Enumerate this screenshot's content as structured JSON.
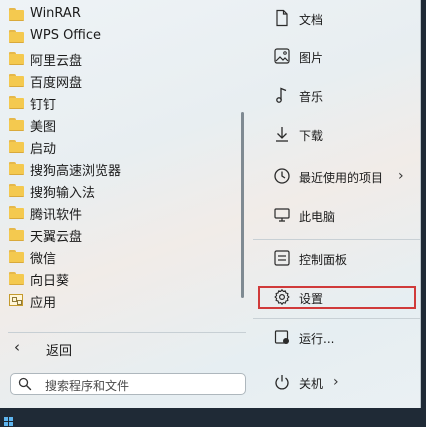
{
  "app_list": [
    {
      "label": "WinRAR",
      "icon": "folder-icon"
    },
    {
      "label": "WPS Office",
      "icon": "folder-icon"
    },
    {
      "label": "阿里云盘",
      "icon": "folder-icon"
    },
    {
      "label": "百度网盘",
      "icon": "folder-icon"
    },
    {
      "label": "钉钉",
      "icon": "folder-icon"
    },
    {
      "label": "美图",
      "icon": "folder-icon"
    },
    {
      "label": "启动",
      "icon": "folder-icon"
    },
    {
      "label": "搜狗高速浏览器",
      "icon": "folder-icon"
    },
    {
      "label": "搜狗输入法",
      "icon": "folder-icon"
    },
    {
      "label": "腾讯软件",
      "icon": "folder-icon"
    },
    {
      "label": "天翼云盘",
      "icon": "folder-icon"
    },
    {
      "label": "微信",
      "icon": "folder-icon"
    },
    {
      "label": "向日葵",
      "icon": "folder-icon"
    },
    {
      "label": "应用",
      "icon": "apps-folder-icon"
    }
  ],
  "back": {
    "label": "返回"
  },
  "search": {
    "placeholder": "搜索程序和文件"
  },
  "right_menu": {
    "documents": "文档",
    "pictures": "图片",
    "music": "音乐",
    "downloads": "下载",
    "recent_items": "最近使用的项目",
    "this_pc": "此电脑",
    "control_panel": "控制面板",
    "settings": "设置",
    "run": "运行...",
    "shutdown": "关机"
  },
  "colors": {
    "folder": "#f4c94f",
    "highlight": "#d03a3a",
    "accent": "#5fb6f0"
  }
}
